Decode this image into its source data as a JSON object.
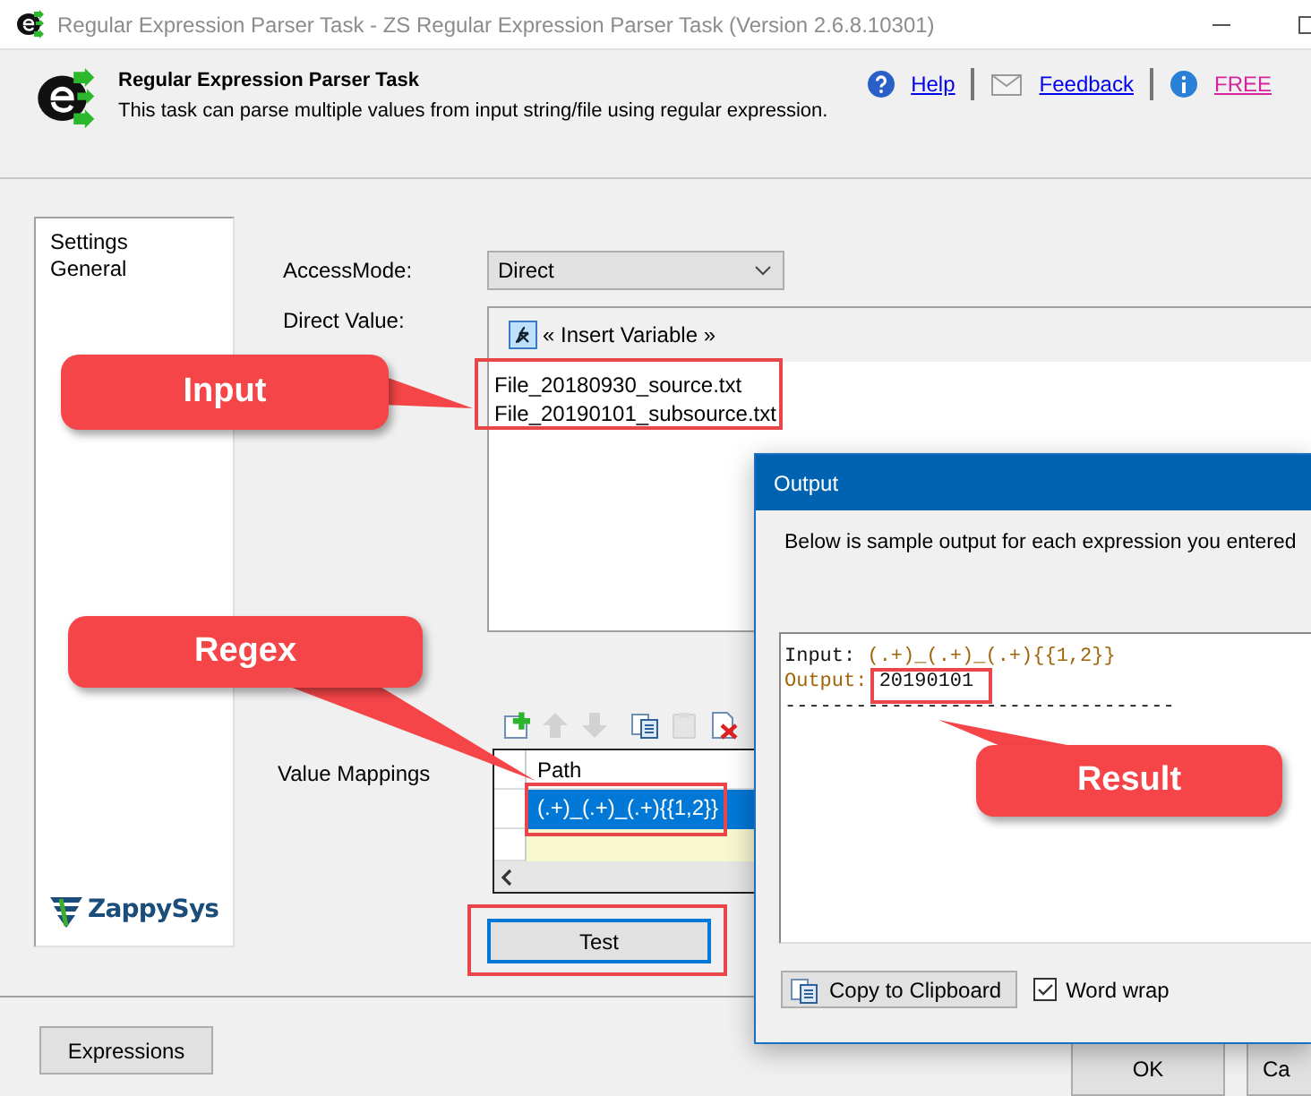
{
  "window": {
    "title": "Regular Expression Parser Task - ZS Regular Expression Parser Task (Version 2.6.8.10301)"
  },
  "header": {
    "title": "Regular Expression Parser Task",
    "description": "This task can parse multiple values from input string/file using regular expression.",
    "links": [
      {
        "kind": "help",
        "label": "Help"
      },
      {
        "kind": "feedback",
        "label": "Feedback"
      },
      {
        "kind": "info",
        "label": "FREE"
      }
    ]
  },
  "sidebar": {
    "items": [
      "Settings",
      "General"
    ],
    "logo": "ZappySys"
  },
  "form": {
    "access_mode": {
      "label": "AccessMode:",
      "value": "Direct"
    },
    "direct_value": {
      "label": "Direct Value:",
      "insert_variable": "« Insert Variable »",
      "lines": [
        "File_20180930_source.txt",
        "File_20190101_subsource.txt"
      ]
    },
    "value_mappings": {
      "label": "Value Mappings",
      "tools": [
        {
          "kind": "add",
          "disabled": false
        },
        {
          "kind": "up",
          "disabled": true
        },
        {
          "kind": "down",
          "disabled": true
        },
        {
          "kind": "copy",
          "disabled": false
        },
        {
          "kind": "paste",
          "disabled": true
        },
        {
          "kind": "delete",
          "disabled": false
        }
      ],
      "columns": [
        "Path"
      ],
      "rows": [
        {
          "path": "(.+)_(.+)_(.+){{1,2}}",
          "selected": true
        }
      ]
    },
    "test_button": "Test"
  },
  "footer": {
    "buttons": [
      "Expressions",
      "OK",
      "Ca"
    ]
  },
  "output_dialog": {
    "title": "Output",
    "intro": "Below is sample output for each expression you entered",
    "lines": [
      {
        "label": "Input:",
        "value": "(.+)_(.+)_(.+){{1,2}}"
      },
      {
        "label": "Output:",
        "value": "20190101"
      },
      {
        "label": "---------------------------------"
      }
    ],
    "copy_button": "Copy to Clipboard",
    "word_wrap": {
      "label": "Word wrap",
      "checked": true
    }
  },
  "callouts": [
    {
      "text": "Input"
    },
    {
      "text": "Regex"
    },
    {
      "text": "Result"
    }
  ]
}
